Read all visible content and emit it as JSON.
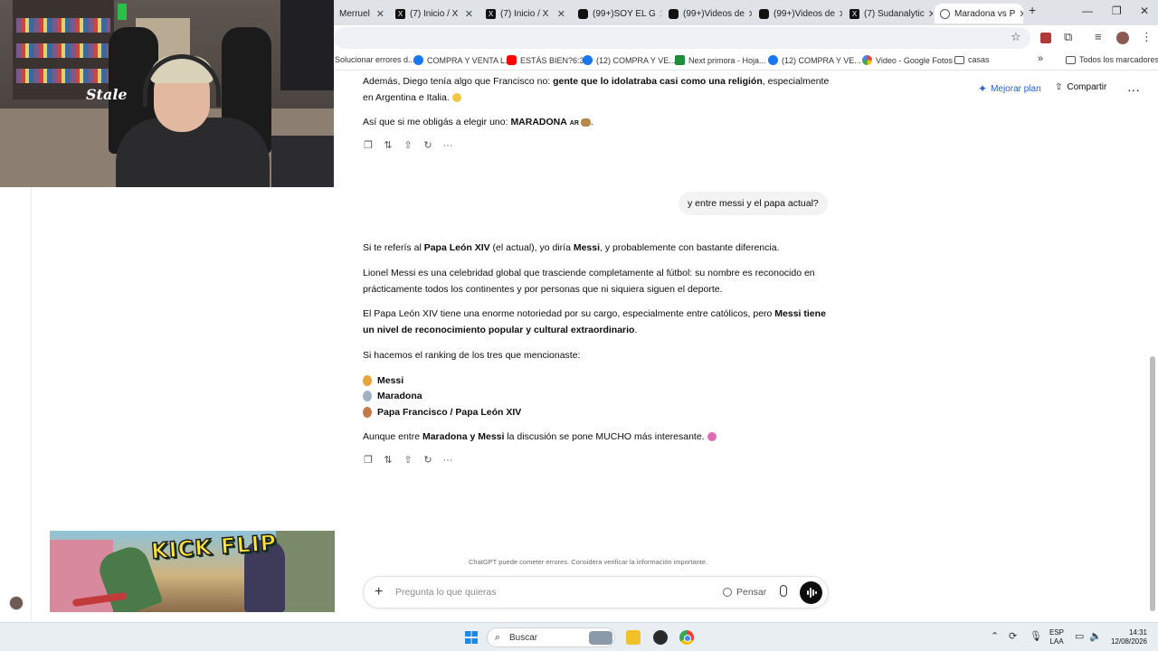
{
  "browser": {
    "tabs": [
      {
        "label": "Merruel",
        "icon": "globe-icon"
      },
      {
        "label": "(7) Inicio / X",
        "icon": "x-logo-icon"
      },
      {
        "label": "(7) Inicio / X",
        "icon": "x-logo-icon"
      },
      {
        "label": "(99+)SOY EL G",
        "icon": "tiktok-icon"
      },
      {
        "label": "(99+)Videos de",
        "icon": "tiktok-icon"
      },
      {
        "label": "(99+)Videos de",
        "icon": "tiktok-icon"
      },
      {
        "label": "(7) Sudanalytic",
        "icon": "x-logo-icon"
      },
      {
        "label": "Maradona vs P",
        "icon": "chatgpt-icon",
        "active": true
      }
    ],
    "new_tab_label": "+",
    "bookmarks": [
      {
        "label": "Solucionar errores d...",
        "icon": "none"
      },
      {
        "label": "COMPRA Y VENTA L...",
        "icon": "facebook-icon"
      },
      {
        "label": "ESTÁS BIEN?6:33",
        "icon": "youtube-icon"
      },
      {
        "label": "(12) COMPRA Y VE...",
        "icon": "facebook-icon"
      },
      {
        "label": "Next primora - Hoja...",
        "icon": "sheets-icon"
      },
      {
        "label": "(12) COMPRA Y VE...",
        "icon": "facebook-icon"
      },
      {
        "label": "Video - Google Fotos",
        "icon": "photos-icon"
      },
      {
        "label": "casas",
        "icon": "folder-icon"
      }
    ],
    "all_bookmarks_label": "Todos los marcadores"
  },
  "header": {
    "upgrade_label": "Mejorar plan",
    "share_label": "Compartir"
  },
  "conversation": {
    "prev_p1_a": "Además, Diego tenía algo que Francisco no: ",
    "prev_p1_b": "gente que lo idolatraba casi como una religión",
    "prev_p1_c": ", especialmente en Argentina e Italia.",
    "prev_p2_a": "Así que si me obligás a elegir uno: ",
    "prev_p2_b": "MARADONA",
    "prev_p2_flag": "AR",
    "prev_p2_c": ".",
    "user_message": "y entre messi y el papa actual?",
    "a1_a": "Si te referís al ",
    "a1_b": "Papa León XIV",
    "a1_c": " (el actual), yo diría ",
    "a1_d": "Messi",
    "a1_e": ", y probablemente con bastante diferencia.",
    "a2": "Lionel Messi es una celebridad global que trasciende completamente al fútbol: su nombre es reconocido en prácticamente todos los continentes y por personas que ni siquiera siguen el deporte.",
    "a3_a": "El Papa León XIV tiene una enorme notoriedad por su cargo, especialmente entre católicos, pero ",
    "a3_b": "Messi tiene un nivel de reconocimiento popular y cultural extraordinario",
    "a3_c": ".",
    "a4": "Si hacemos el ranking de los tres que mencionaste:",
    "ranking": [
      "Messi",
      "Maradona",
      "Papa Francisco / Papa León XIV"
    ],
    "a5_a": "Aunque entre ",
    "a5_b": "Maradona y Messi",
    "a5_c": " la discusión se pone MUCHO más interesante."
  },
  "composer": {
    "disclaimer": "ChatGPT puede cometer errores. Considera verificar la información importante.",
    "placeholder": "Pregunta lo que quieras",
    "think_label": "Pensar"
  },
  "overlays": {
    "webcam_sign": "Stale",
    "game_title": "KICK FLIP"
  },
  "taskbar": {
    "search_label": "Buscar",
    "lang_1": "ESP",
    "lang_2": "LAA",
    "time": "14:31",
    "date": "12/08/2026"
  },
  "colors": {
    "accent_upgrade": "#2c5ec9",
    "user_bubble": "#f3f3f3",
    "taskbar": "#e9eef3"
  }
}
